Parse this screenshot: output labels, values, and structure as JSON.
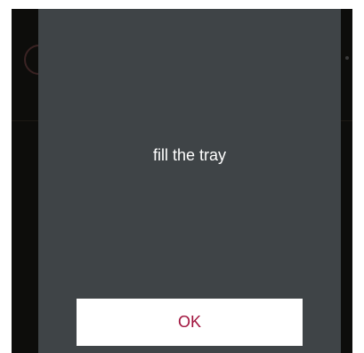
{
  "dialog": {
    "message": "fill the tray",
    "ok_label": "OK"
  },
  "colors": {
    "dialog_background": "#3f4447",
    "button_text": "#a0123c",
    "message_text": "#ffffff"
  }
}
